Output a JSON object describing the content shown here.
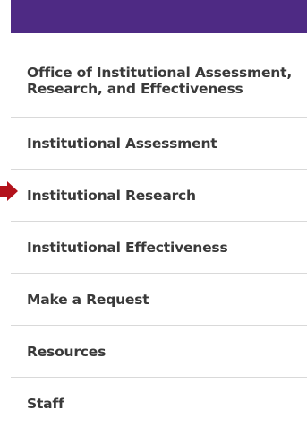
{
  "nav": {
    "items": [
      {
        "label": "Office of Institutional Assessment, Research, and Effectiveness"
      },
      {
        "label": "Institutional Assessment"
      },
      {
        "label": "Institutional Research"
      },
      {
        "label": "Institutional Effectiveness"
      },
      {
        "label": "Make a Request"
      },
      {
        "label": "Resources"
      },
      {
        "label": "Staff"
      }
    ]
  },
  "colors": {
    "header_bar": "#4e2a84",
    "arrow": "#b3121b",
    "text": "#3a3a3a",
    "divider": "#d9d9d9"
  },
  "icons": {
    "pointer": "arrow-right-icon"
  }
}
